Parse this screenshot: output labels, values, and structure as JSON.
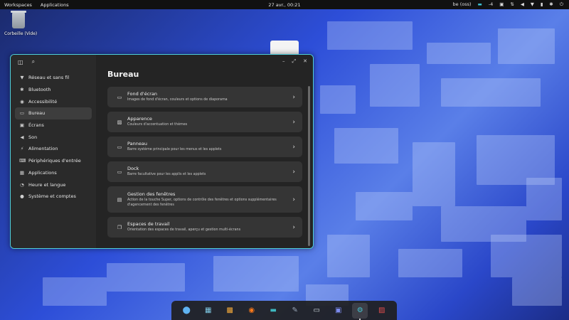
{
  "topbar": {
    "workspaces": "Workspaces",
    "applications": "Applications",
    "clock": "27 avr., 00:21",
    "keyboard_layout": "be (oss)",
    "tray_value": "-4"
  },
  "desktop": {
    "trash_label": "Corbeille (Vide)"
  },
  "window": {
    "page_title": "Bureau",
    "controls": {
      "minimize": "–",
      "maximize": "⤢",
      "close": "✕"
    },
    "sidebar": {
      "items": [
        {
          "label": "Réseau et sans fil",
          "icon": "wifi-icon",
          "glyph": "▼"
        },
        {
          "label": "Bluetooth",
          "icon": "bluetooth-icon",
          "glyph": "✱"
        },
        {
          "label": "Accessibilité",
          "icon": "accessibility-icon",
          "glyph": "◉"
        },
        {
          "label": "Bureau",
          "icon": "desktop-icon",
          "glyph": "▭"
        },
        {
          "label": "Écrans",
          "icon": "display-icon",
          "glyph": "▣"
        },
        {
          "label": "Son",
          "icon": "sound-icon",
          "glyph": "◀"
        },
        {
          "label": "Alimentation",
          "icon": "power-icon",
          "glyph": "⚡"
        },
        {
          "label": "Périphériques d'entrée",
          "icon": "input-devices-icon",
          "glyph": "⌨"
        },
        {
          "label": "Applications",
          "icon": "applications-icon",
          "glyph": "▦"
        },
        {
          "label": "Heure et langue",
          "icon": "clock-icon",
          "glyph": "◔"
        },
        {
          "label": "Système et comptes",
          "icon": "users-icon",
          "glyph": "●"
        }
      ]
    },
    "cards": [
      {
        "title": "Fond d'écran",
        "desc": "Images de fond d'écran, couleurs et options de diaporama",
        "icon": "wallpaper-icon",
        "glyph": "▭"
      },
      {
        "title": "Apparence",
        "desc": "Couleurs d'accentuation et thèmes",
        "icon": "appearance-icon",
        "glyph": "▨"
      },
      {
        "title": "Panneau",
        "desc": "Barre système principale pour les menus et les applets",
        "icon": "panel-icon",
        "glyph": "▭"
      },
      {
        "title": "Dock",
        "desc": "Barre facultative pour les applis et les applets",
        "icon": "dock-icon",
        "glyph": "▭"
      },
      {
        "title": "Gestion des fenêtres",
        "desc": "Action de la touche Super, options de contrôle des fenêtres et options supplémentaires d'agencement des fenêtres",
        "icon": "window-management-icon",
        "glyph": "▤"
      },
      {
        "title": "Espaces de travail",
        "desc": "Orientation des espaces de travail, aperçu et gestion multi-écrans",
        "icon": "workspaces-icon",
        "glyph": "❐"
      }
    ]
  },
  "dock": {
    "items": [
      {
        "name": "launcher-icon",
        "glyph": "⬤",
        "color": "#5fb3f2"
      },
      {
        "name": "workspaces-app-icon",
        "glyph": "▦",
        "color": "#7ec8e3"
      },
      {
        "name": "app-library-icon",
        "glyph": "▩",
        "color": "#f2a93b"
      },
      {
        "name": "firefox-icon",
        "glyph": "◉",
        "color": "#ff7a1a"
      },
      {
        "name": "files-icon",
        "glyph": "▬",
        "color": "#3eb8c0"
      },
      {
        "name": "text-editor-icon",
        "glyph": "✎",
        "color": "#9aa7b8"
      },
      {
        "name": "terminal-icon",
        "glyph": "▭",
        "color": "#cfd6dd"
      },
      {
        "name": "store-icon",
        "glyph": "▣",
        "color": "#7d8cf0"
      },
      {
        "name": "settings-icon",
        "glyph": "⚙",
        "color": "#48c4d1"
      },
      {
        "name": "screenshot-icon",
        "glyph": "▨",
        "color": "#e24d4d"
      }
    ]
  }
}
